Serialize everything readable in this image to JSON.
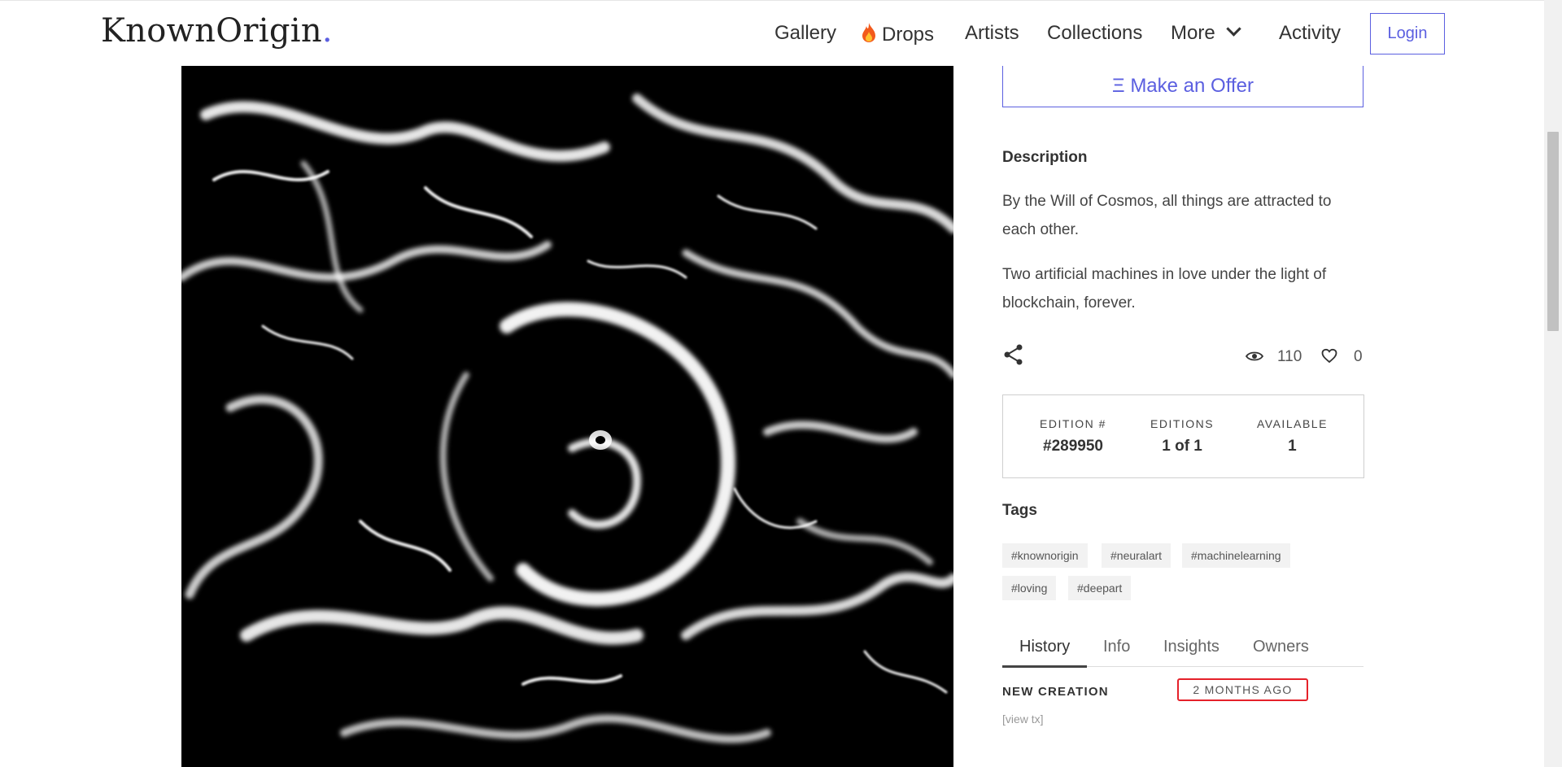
{
  "brand": {
    "name": "KnownOrigin",
    "dot": ".",
    "accent": "#5b5fe0"
  },
  "nav": {
    "gallery": "Gallery",
    "drops": "Drops",
    "artists": "Artists",
    "collections": "Collections",
    "more": "More",
    "activity": "Activity",
    "login": "Login"
  },
  "offer": {
    "label": "Ξ Make an Offer"
  },
  "description": {
    "heading": "Description",
    "p1": "By the Will of Cosmos, all things are attracted to each other.",
    "p2": "Two artificial machines in love under the light of blockchain, forever."
  },
  "stats": {
    "views": "110",
    "likes": "0"
  },
  "edition": {
    "edition_label": "EDITION #",
    "edition_value": "#289950",
    "editions_label": "EDITIONS",
    "editions_value": "1 of 1",
    "available_label": "AVAILABLE",
    "available_value": "1"
  },
  "tags": {
    "heading": "Tags",
    "items": [
      "#knownorigin",
      "#neuralart",
      "#machinelearning",
      "#loving",
      "#deepart"
    ]
  },
  "tabs": [
    "History",
    "Info",
    "Insights",
    "Owners"
  ],
  "history": {
    "type": "NEW CREATION",
    "time": "2 MONTHS AGO",
    "link": "[view tx]"
  },
  "colors": {
    "highlight": "#e5212a"
  }
}
